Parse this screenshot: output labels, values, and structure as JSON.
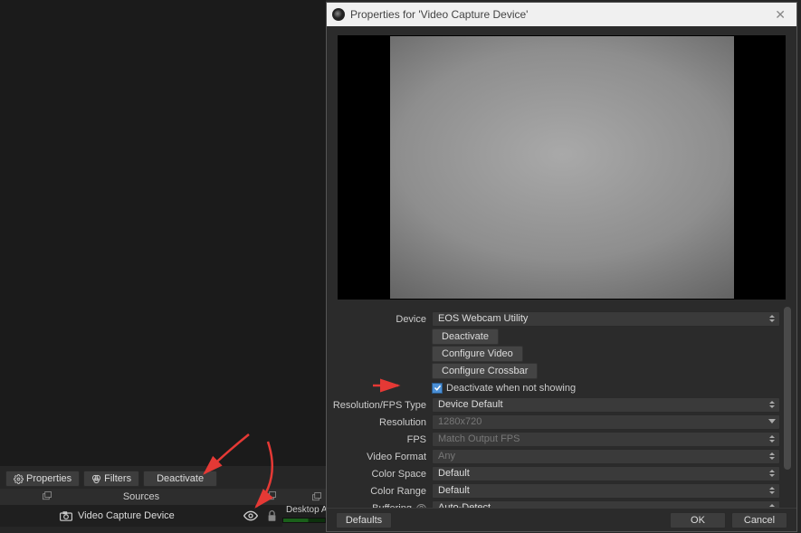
{
  "toolbar": {
    "properties_label": "Properties",
    "filters_label": "Filters",
    "deactivate_label": "Deactivate"
  },
  "sources_panel": {
    "title": "Sources",
    "items": [
      {
        "label": "Video Capture Device"
      }
    ]
  },
  "mixer": {
    "channel_label": "Desktop Au"
  },
  "dialog": {
    "title": "Properties for 'Video Capture Device'",
    "form": {
      "device_label": "Device",
      "device_value": "EOS Webcam Utility",
      "btn_deactivate": "Deactivate",
      "btn_configure_video": "Configure Video",
      "btn_configure_crossbar": "Configure Crossbar",
      "chk_deactivate_label": "Deactivate when not showing",
      "chk_deactivate_checked": true,
      "res_fps_type_label": "Resolution/FPS Type",
      "res_fps_type_value": "Device Default",
      "resolution_label": "Resolution",
      "resolution_value": "1280x720",
      "fps_label": "FPS",
      "fps_value": "Match Output FPS",
      "video_format_label": "Video Format",
      "video_format_value": "Any",
      "color_space_label": "Color Space",
      "color_space_value": "Default",
      "color_range_label": "Color Range",
      "color_range_value": "Default",
      "buffering_label": "Buffering",
      "buffering_value": "Auto-Detect"
    },
    "footer": {
      "defaults_label": "Defaults",
      "ok_label": "OK",
      "cancel_label": "Cancel"
    }
  }
}
